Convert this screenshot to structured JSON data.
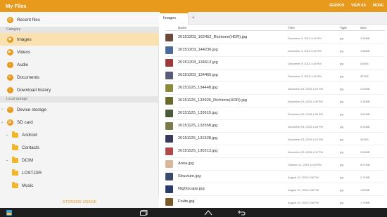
{
  "app": {
    "title": "My Files"
  },
  "toolbar": {
    "search_label": "SEARCH",
    "view_as_label": "VIEW AS",
    "more_label": "MORE"
  },
  "sidebar": {
    "recent_label": "Recent files",
    "category_header": "Category",
    "categories": [
      {
        "label": "Images",
        "icon": "image-icon",
        "selected": true
      },
      {
        "label": "Videos",
        "icon": "video-icon",
        "selected": false
      },
      {
        "label": "Audio",
        "icon": "audio-icon",
        "selected": false
      },
      {
        "label": "Documents",
        "icon": "document-icon",
        "selected": false
      },
      {
        "label": "Download history",
        "icon": "download-icon",
        "selected": false
      }
    ],
    "local_header": "Local storage",
    "storage": [
      {
        "label": "Device storage"
      },
      {
        "label": "SD card"
      }
    ],
    "folders": [
      {
        "label": "Android"
      },
      {
        "label": "Contacts"
      },
      {
        "label": "DCIM"
      },
      {
        "label": "LOST.DIR"
      },
      {
        "label": "Music"
      }
    ],
    "storage_usage_label": "STORAGE USAGE"
  },
  "tabs": [
    {
      "label": "Images"
    }
  ],
  "tab_add_label": "+",
  "columns": {
    "name": "Name",
    "time": "Time",
    "type": "Type",
    "size": "Size"
  },
  "files": [
    {
      "name": "20151203_162452_Richtone(HDR).jpg",
      "time": "December 3, 2015  4:24 PM",
      "type": "jpg",
      "size": "3.90MB",
      "thumb": "#6a4a3a"
    },
    {
      "name": "20151203_144236.jpg",
      "time": "December 3, 2015  2:42 PM",
      "type": "jpg",
      "size": "3.58MB",
      "thumb": "#4a6a9a"
    },
    {
      "name": "20151203_134613.jpg",
      "time": "December 3, 2015  1:46 PM",
      "type": "jpg",
      "size": "516KB",
      "thumb": "#9a3a3a"
    },
    {
      "name": "20151203_134455.jpg",
      "time": "December 3, 2015  1:44 PM",
      "type": "jpg",
      "size": "907KB",
      "thumb": "#5a5a7a"
    },
    {
      "name": "20151125_134448.jpg",
      "time": "November 25, 2015  1:44 PM",
      "type": "jpg",
      "size": "2.03MB",
      "thumb": "#8a8a3a"
    },
    {
      "name": "20151125_133926_Richtone(HDR).jpg",
      "time": "November 25, 2015  1:39 PM",
      "type": "jpg",
      "size": "3.35MB",
      "thumb": "#6a6a2a"
    },
    {
      "name": "20151125_133615.jpg",
      "time": "November 25, 2015  1:36 PM",
      "type": "jpg",
      "size": "3.61MB",
      "thumb": "#4a5a3a"
    },
    {
      "name": "20151125_133558.jpg",
      "time": "November 25, 2015  1:35 PM",
      "type": "jpg",
      "size": "5.19MB",
      "thumb": "#7a7a4a"
    },
    {
      "name": "20151125_131528.jpg",
      "time": "November 25, 2015  1:15 PM",
      "type": "jpg",
      "size": "292KB",
      "thumb": "#3a3a5a"
    },
    {
      "name": "20151125_130213.jpg",
      "time": "November 25, 2015  1:02 PM",
      "type": "jpg",
      "size": "2.60MB",
      "thumb": "#b04a4a"
    },
    {
      "name": "Anna.jpg",
      "time": "October 12, 2015  12:00 PM",
      "type": "jpg",
      "size": "8.07MB",
      "thumb": "#d8b89a"
    },
    {
      "name": "Structure.jpg",
      "time": "August 19, 2015  3:36 PM",
      "type": "jpg",
      "size": "2.74MB",
      "thumb": "#3a4a6a"
    },
    {
      "name": "Nightscape.jpg",
      "time": "August 19, 2015  3:36 PM",
      "type": "jpg",
      "size": "1.80MB",
      "thumb": "#2a3a6a"
    },
    {
      "name": "Fruits.jpg",
      "time": "August 19, 2015  3:36 PM",
      "type": "jpg",
      "size": "1.79MB",
      "thumb": "#7a5a2a"
    }
  ],
  "colors": {
    "accent": "#e89a1c",
    "selected_bg": "#fbe0b0",
    "nav_bg": "#1e1e1e"
  },
  "navbar": [
    {
      "icon": "gallery-app-icon"
    },
    {
      "icon": "recent-apps-icon"
    },
    {
      "icon": "home-icon"
    },
    {
      "icon": "back-icon"
    }
  ]
}
